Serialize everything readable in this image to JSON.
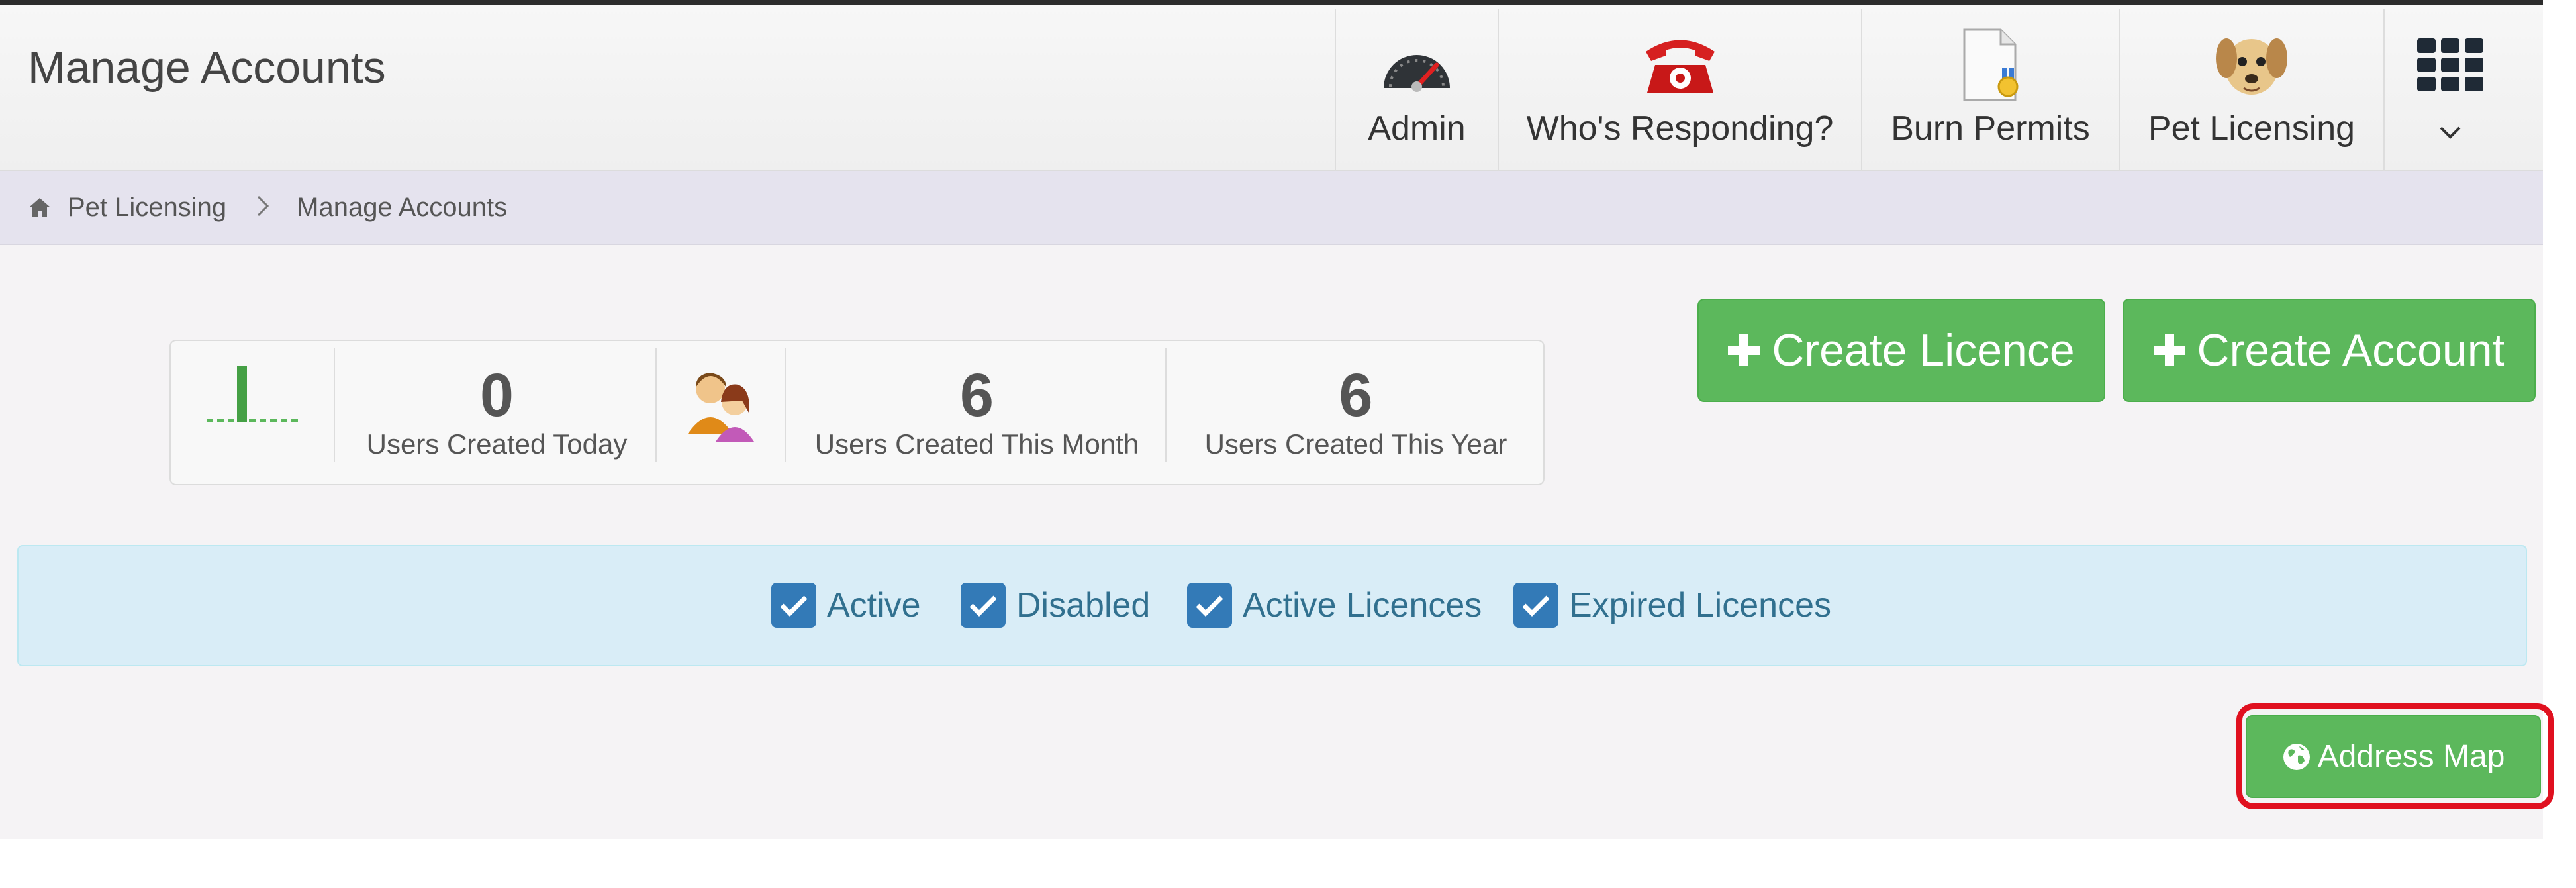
{
  "header": {
    "title": "Manage Accounts",
    "nav": [
      {
        "label": "Admin",
        "icon": "speedometer-icon"
      },
      {
        "label": "Who's Responding?",
        "icon": "red-phone-icon"
      },
      {
        "label": "Burn Permits",
        "icon": "certificate-document-icon"
      },
      {
        "label": "Pet Licensing",
        "icon": "dog-icon"
      }
    ],
    "apps_icon": "apps-grid-icon",
    "apps_chevron": "chevron-down-icon"
  },
  "breadcrumb": {
    "home_icon": "home-icon",
    "items": [
      "Pet Licensing",
      "Manage Accounts"
    ]
  },
  "stats": {
    "today": {
      "value": "0",
      "label": "Users Created Today"
    },
    "month": {
      "value": "6",
      "label": "Users Created This Month"
    },
    "year": {
      "value": "6",
      "label": "Users Created This Year"
    }
  },
  "actions": {
    "create_licence": "Create Licence",
    "create_account": "Create Account",
    "address_map": "Address Map"
  },
  "filters": [
    {
      "label": "Active",
      "checked": true
    },
    {
      "label": "Disabled",
      "checked": true
    },
    {
      "label": "Active Licences",
      "checked": true
    },
    {
      "label": "Expired Licences",
      "checked": true
    }
  ],
  "colors": {
    "success": "#5cb85c",
    "info_bg": "#d9edf7",
    "checkbox": "#337ab7",
    "highlight": "#e0101f"
  }
}
